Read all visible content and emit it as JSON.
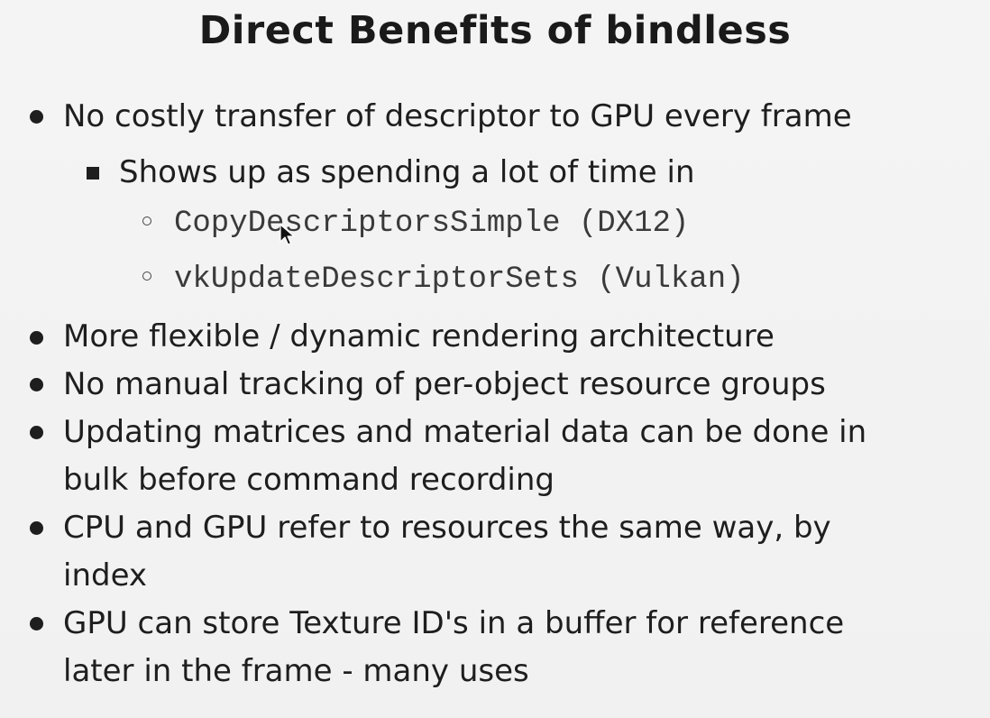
{
  "slide": {
    "title": "Direct Benefits of bindless",
    "bullets": [
      {
        "lines": [
          "No costly transfer of descriptor to GPU every frame"
        ]
      },
      {
        "lines": [
          "More flexible / dynamic rendering architecture"
        ]
      },
      {
        "lines": [
          "No manual tracking of per-object resource groups"
        ]
      },
      {
        "lines": [
          "Updating matrices and material data can be done in",
          "bulk before command recording"
        ]
      },
      {
        "lines": [
          "CPU and GPU refer to resources the same way, by",
          "index"
        ]
      },
      {
        "lines": [
          "GPU can store Texture ID's in a buffer for  reference",
          "later in the frame - many uses"
        ]
      }
    ],
    "sub_bullet": "Shows up as spending a lot of time in",
    "code_items": [
      "CopyDescriptorsSimple (DX12)",
      "vkUpdateDescriptorSets (Vulkan)"
    ]
  },
  "icons": {
    "cursor": "mouse-pointer-icon"
  }
}
